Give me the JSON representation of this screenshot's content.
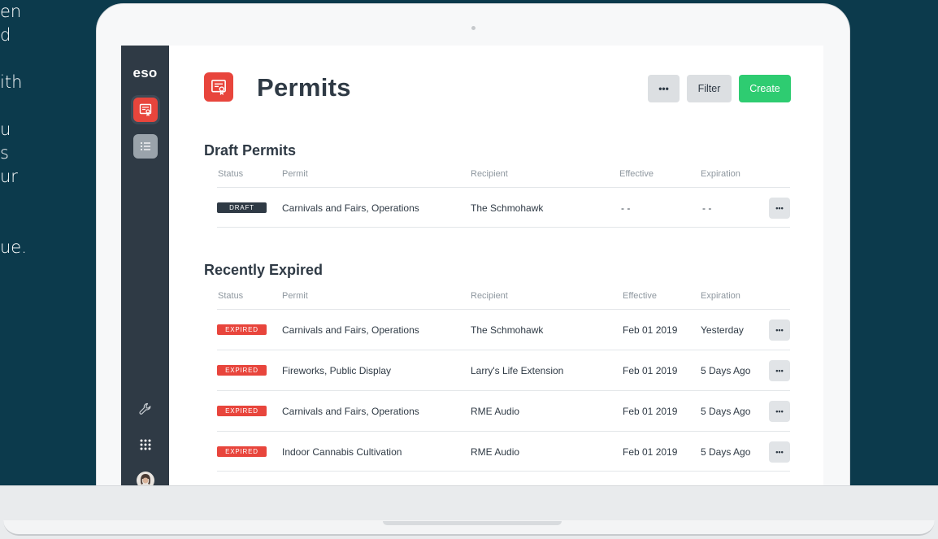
{
  "background_text": [
    "en",
    "d",
    "",
    "ith",
    "",
    "u",
    "s",
    "ur",
    "",
    "",
    "ue."
  ],
  "sidebar": {
    "logo": "eso",
    "items": [
      {
        "name": "permits",
        "icon": "permit-icon",
        "active": true
      },
      {
        "name": "list",
        "icon": "list-icon",
        "active": false
      }
    ],
    "bottom": [
      {
        "name": "tools",
        "icon": "wrench-icon"
      },
      {
        "name": "apps",
        "icon": "grid-icon"
      },
      {
        "name": "profile",
        "icon": "avatar"
      }
    ]
  },
  "header": {
    "title": "Permits",
    "icon": "permit-icon",
    "more_label": "•••",
    "filter_label": "Filter",
    "create_label": "Create"
  },
  "draft_section": {
    "title": "Draft Permits",
    "columns": [
      "Status",
      "Permit",
      "Recipient",
      "Effective",
      "Expiration"
    ],
    "rows": [
      {
        "status": "DRAFT",
        "permit": "Carnivals and Fairs, Operations",
        "recipient": "The Schmohawk",
        "effective": "- -",
        "expiration": "- -"
      }
    ]
  },
  "expired_section": {
    "title": "Recently Expired",
    "columns": [
      "Status",
      "Permit",
      "Recipient",
      "Effective",
      "Expiration"
    ],
    "rows": [
      {
        "status": "EXPIRED",
        "permit": "Carnivals and Fairs, Operations",
        "recipient": "The Schmohawk",
        "effective": "Feb 01 2019",
        "expiration": "Yesterday"
      },
      {
        "status": "EXPIRED",
        "permit": "Fireworks, Public Display",
        "recipient": "Larry's Life Extension",
        "effective": "Feb 01 2019",
        "expiration": "5 Days Ago"
      },
      {
        "status": "EXPIRED",
        "permit": "Carnivals and Fairs, Operations",
        "recipient": "RME Audio",
        "effective": "Feb 01 2019",
        "expiration": "5 Days Ago"
      },
      {
        "status": "EXPIRED",
        "permit": "Indoor Cannabis Cultivation",
        "recipient": "RME Audio",
        "effective": "Feb 01 2019",
        "expiration": "5 Days Ago"
      }
    ]
  },
  "row_more_label": "•••",
  "colors": {
    "accent_red": "#e8453c",
    "create_green": "#2ecc71",
    "sidebar_bg": "#2f3a45",
    "page_bg": "#0c3a4c"
  }
}
